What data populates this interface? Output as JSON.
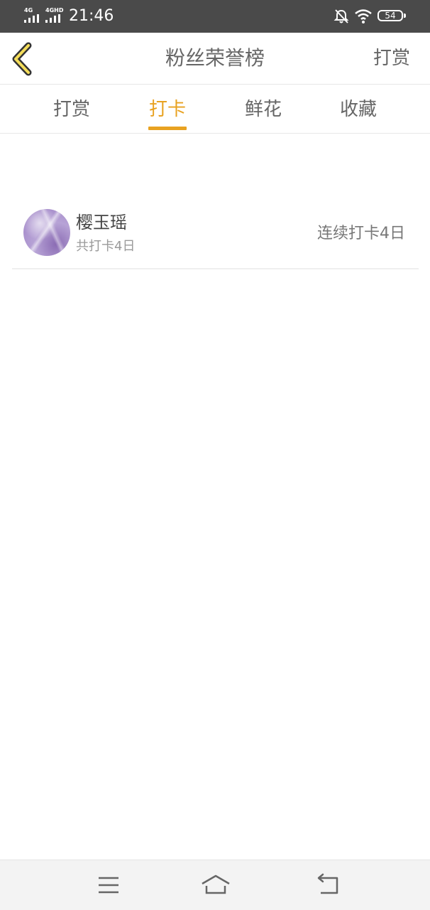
{
  "status_bar": {
    "signal_1_label": "4G",
    "signal_2_label": "4GHD",
    "time": "21:46",
    "battery": "54",
    "icons": [
      "signal-icon",
      "signal-icon",
      "mute-bell-icon",
      "wifi-icon",
      "battery-icon"
    ]
  },
  "header": {
    "title": "粉丝荣誉榜",
    "action_label": "打赏",
    "back_icon": "chevron-left-icon"
  },
  "tabs": [
    {
      "label": "打赏",
      "active": false
    },
    {
      "label": "打卡",
      "active": true
    },
    {
      "label": "鲜花",
      "active": false
    },
    {
      "label": "收藏",
      "active": false
    }
  ],
  "list": [
    {
      "name": "樱玉瑶",
      "total": "共打卡4日",
      "streak": "连续打卡4日"
    }
  ],
  "nav_bar": {
    "icons": [
      "menu-icon",
      "home-icon",
      "back-icon"
    ]
  },
  "colors": {
    "accent": "#e8a221",
    "status_bar": "#4a4a4a",
    "text": "#666666"
  }
}
